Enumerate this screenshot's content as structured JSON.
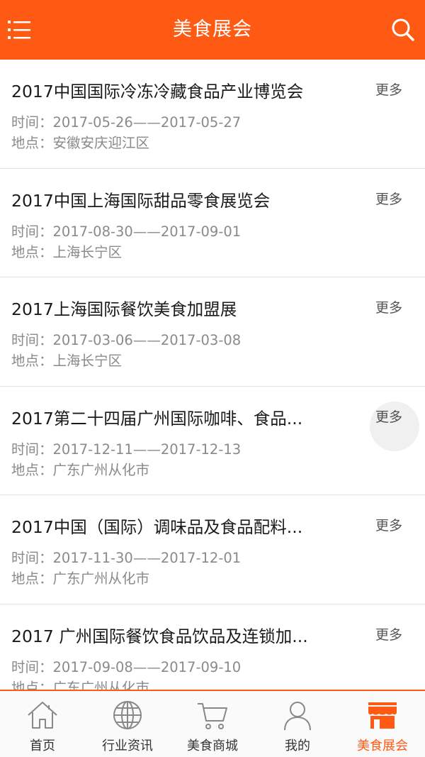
{
  "header": {
    "title": "美食展会",
    "menu_icon": "menu-icon",
    "search_icon": "search-icon",
    "color": "#ff5a14"
  },
  "list": {
    "items": [
      {
        "title": "2017中国国际冷冻冷藏食品产业博览会",
        "more": "更多",
        "time_label": "时间：",
        "time": "2017-05-26——2017-05-27",
        "place_label": "地点：",
        "place": "安徽安庆迎江区"
      },
      {
        "title": "2017中国上海国际甜品零食展览会",
        "more": "更多",
        "time_label": "时间：",
        "time": "2017-08-30——2017-09-01",
        "place_label": "地点：",
        "place": "上海长宁区"
      },
      {
        "title": "2017上海国际餐饮美食加盟展",
        "more": "更多",
        "time_label": "时间：",
        "time": "2017-03-06——2017-03-08",
        "place_label": "地点：",
        "place": "上海长宁区"
      },
      {
        "title": "2017第二十四届广州国际咖啡、食品...",
        "more": "更多",
        "time_label": "时间：",
        "time": "2017-12-11——2017-12-13",
        "place_label": "地点：",
        "place": "广东广州从化市"
      },
      {
        "title": "2017中国（国际）调味品及食品配料...",
        "more": "更多",
        "time_label": "时间：",
        "time": "2017-11-30——2017-12-01",
        "place_label": "地点：",
        "place": "广东广州从化市"
      },
      {
        "title": "2017 广州国际餐饮食品饮品及连锁加...",
        "more": "更多",
        "time_label": "时间：",
        "time": "2017-09-08——2017-09-10",
        "place_label": "地点：",
        "place": "广东广州从化市"
      }
    ]
  },
  "tabbar": {
    "active_color": "#ff5a14",
    "tabs": [
      {
        "label": "首页",
        "icon": "home-icon"
      },
      {
        "label": "行业资讯",
        "icon": "globe-icon"
      },
      {
        "label": "美食商城",
        "icon": "cart-icon"
      },
      {
        "label": "我的",
        "icon": "person-icon"
      },
      {
        "label": "美食展会",
        "icon": "store-icon",
        "active": true
      }
    ]
  }
}
